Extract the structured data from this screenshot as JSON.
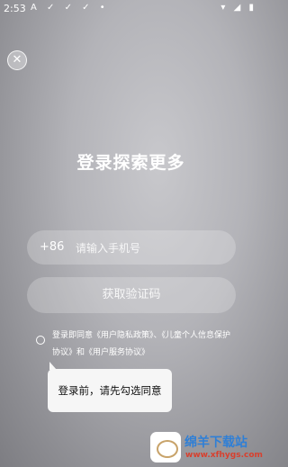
{
  "statusbar": {
    "time": "2:53",
    "left_icons": "A ✓ ✓ ✓ •",
    "right_icons": "▾ ◢ ▮"
  },
  "close": {
    "icon": "close-icon",
    "glyph": "✕"
  },
  "title": "登录探索更多",
  "phone": {
    "country_code": "+86",
    "placeholder": "请输入手机号"
  },
  "get_code_label": "获取验证码",
  "agreement": {
    "prefix": "登录即同意",
    "privacy": "《用户隐私政策》",
    "sep": "、",
    "child": "《儿童个人信息保护协议》",
    "and": "和",
    "service": "《用户服务协议》"
  },
  "toast": "登录前，请先勾选同意",
  "watermark": {
    "name": "绵羊下载站",
    "url": "www.xfhygs.com"
  }
}
